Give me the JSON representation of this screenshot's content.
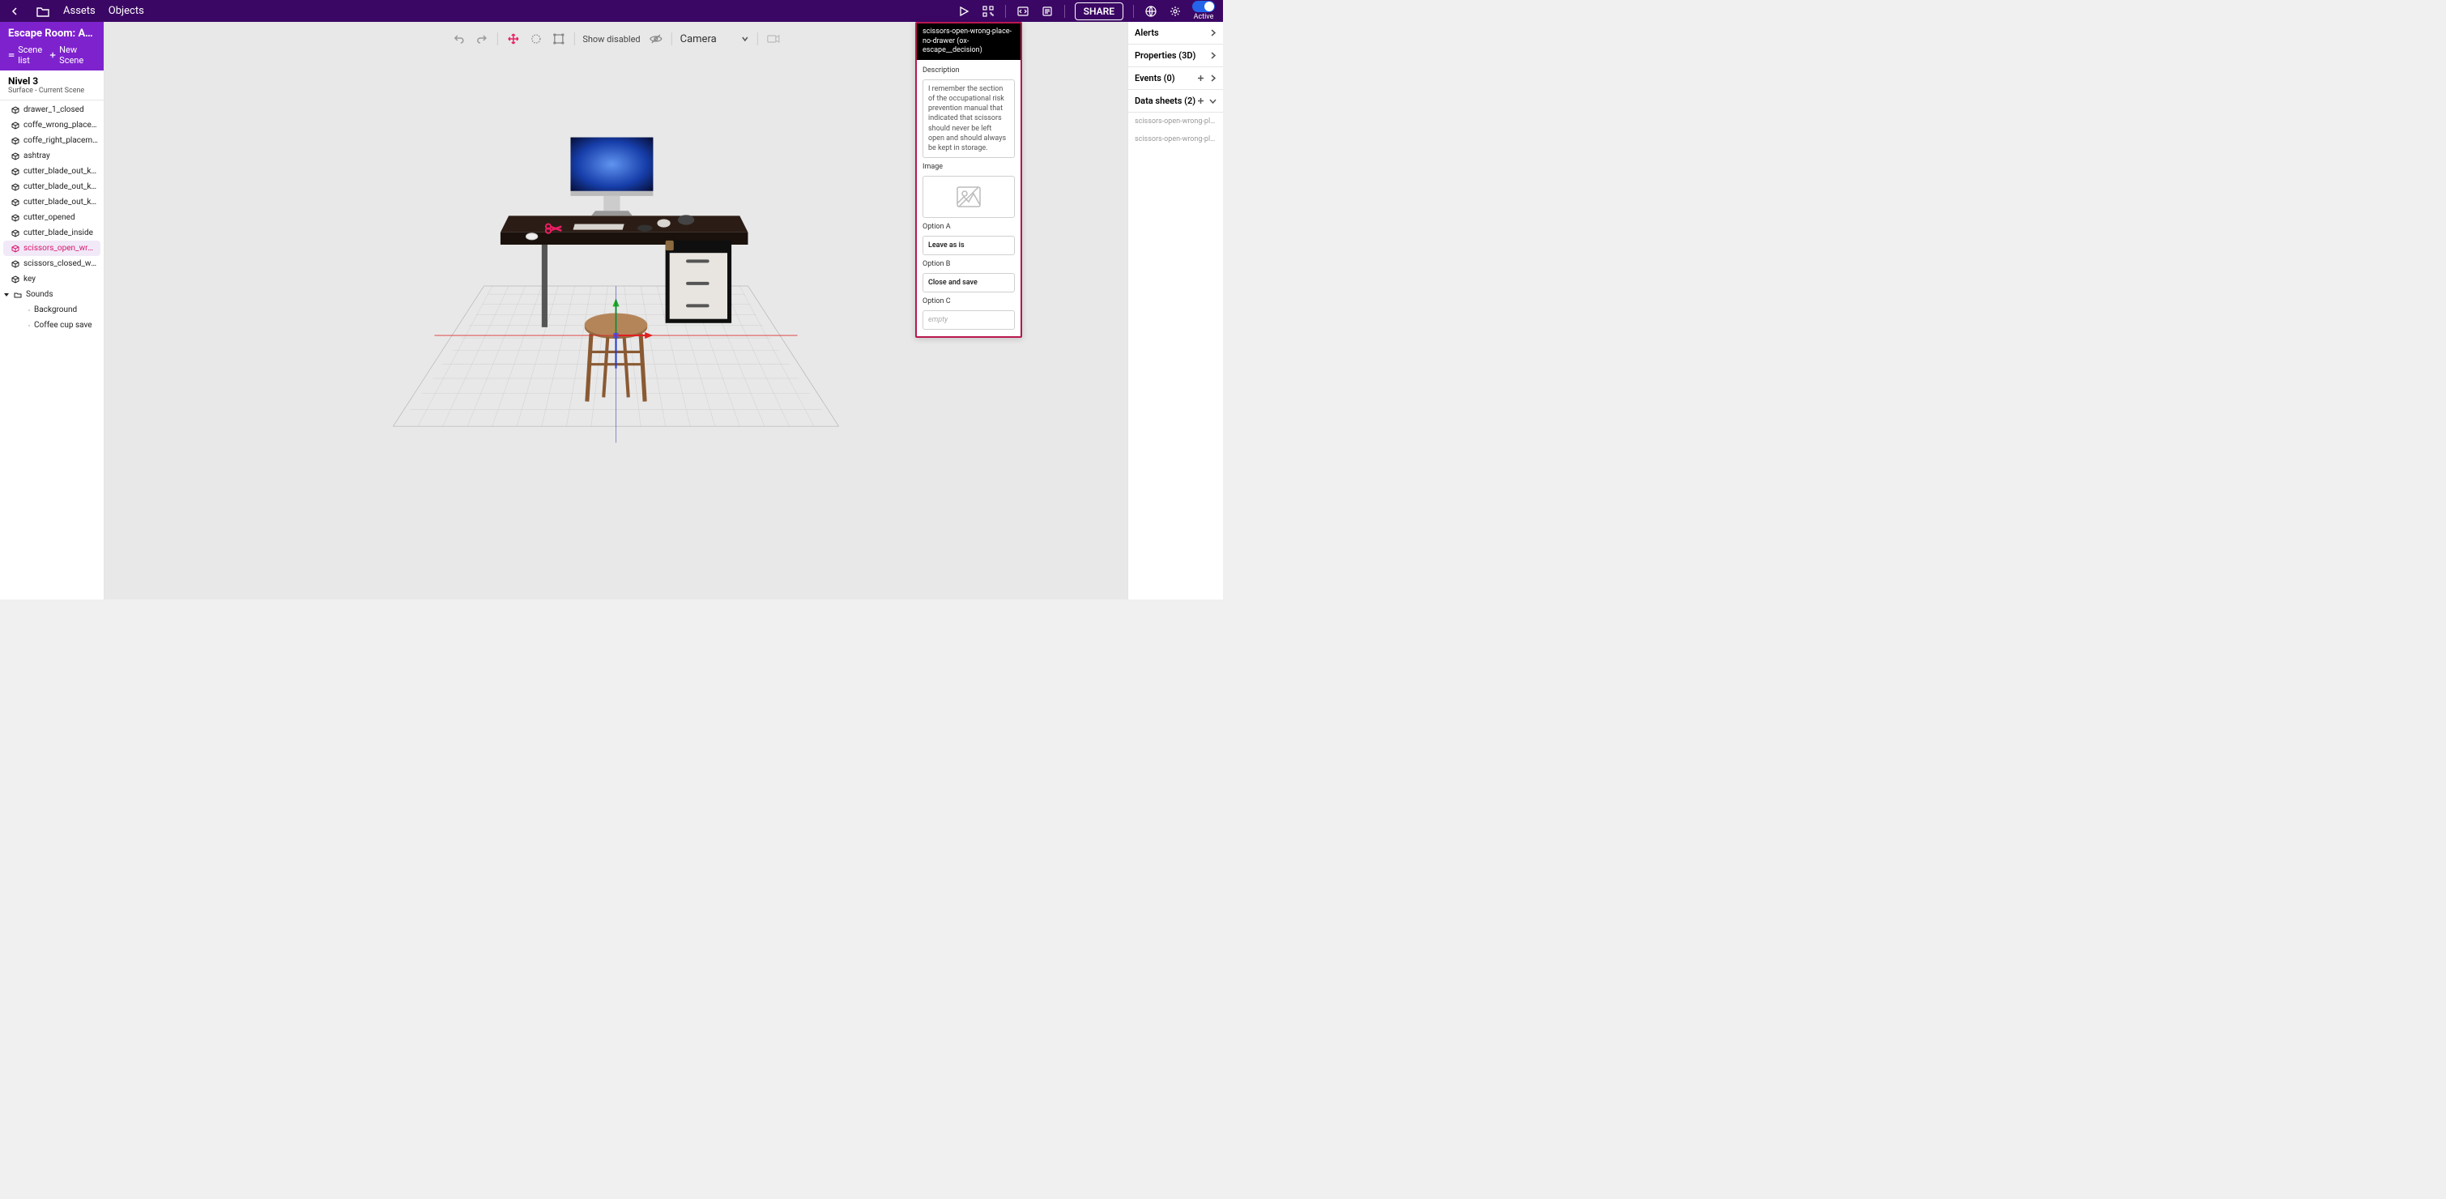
{
  "topbar": {
    "nav": [
      "Assets",
      "Objects"
    ],
    "share": "SHARE",
    "active": "Active"
  },
  "project": {
    "title": "Escape Room: An a...",
    "scene_list": "Scene list",
    "new_scene": "New Scene"
  },
  "scene": {
    "name": "Nivel 3",
    "subtitle": "Surface - Current Scene"
  },
  "tree": {
    "items": [
      {
        "label": "drawer_1_closed",
        "type": "obj"
      },
      {
        "label": "coffe_wrong_placement",
        "type": "obj"
      },
      {
        "label": "coffe_right_placement",
        "type": "obj"
      },
      {
        "label": "ashtray",
        "type": "obj"
      },
      {
        "label": "cutter_blade_out_key_inside_sc...",
        "type": "obj"
      },
      {
        "label": "cutter_blade_out_key_inside_m...",
        "type": "obj"
      },
      {
        "label": "cutter_blade_out_key_inside",
        "type": "obj"
      },
      {
        "label": "cutter_opened",
        "type": "obj"
      },
      {
        "label": "cutter_blade_inside",
        "type": "obj"
      },
      {
        "label": "scissors_open_wrong_placeme...",
        "type": "obj",
        "selected": true
      },
      {
        "label": "scissors_closed_wrong_placem...",
        "type": "obj"
      },
      {
        "label": "key",
        "type": "obj"
      },
      {
        "label": "Sounds",
        "type": "group"
      },
      {
        "label": "Background",
        "type": "sound"
      },
      {
        "label": "Coffee cup save",
        "type": "sound"
      }
    ]
  },
  "viewport": {
    "show_disabled": "Show disabled",
    "camera": "Camera"
  },
  "overlay": {
    "title": "scissors-open-wrong-place-no-drawer (ox-escape__decision)",
    "desc_label": "Description",
    "desc_value": "I remember the section of the occupational risk prevention manual that indicated that scissors should never be left open and should always be kept in storage.",
    "image_label": "Image",
    "opt_a_label": "Option A",
    "opt_a_value": "Leave as is",
    "opt_b_label": "Option B",
    "opt_b_value": "Close and save",
    "opt_c_label": "Option C",
    "opt_c_value": "empty"
  },
  "right": {
    "alerts": "Alerts",
    "properties": "Properties (3D)",
    "events": "Events (0)",
    "datasheets": "Data sheets (2)",
    "ds_items": [
      "scissors-open-wrong-place-no-drawer (...",
      "scissors-open-wrong-place-no-drawer (..."
    ]
  }
}
